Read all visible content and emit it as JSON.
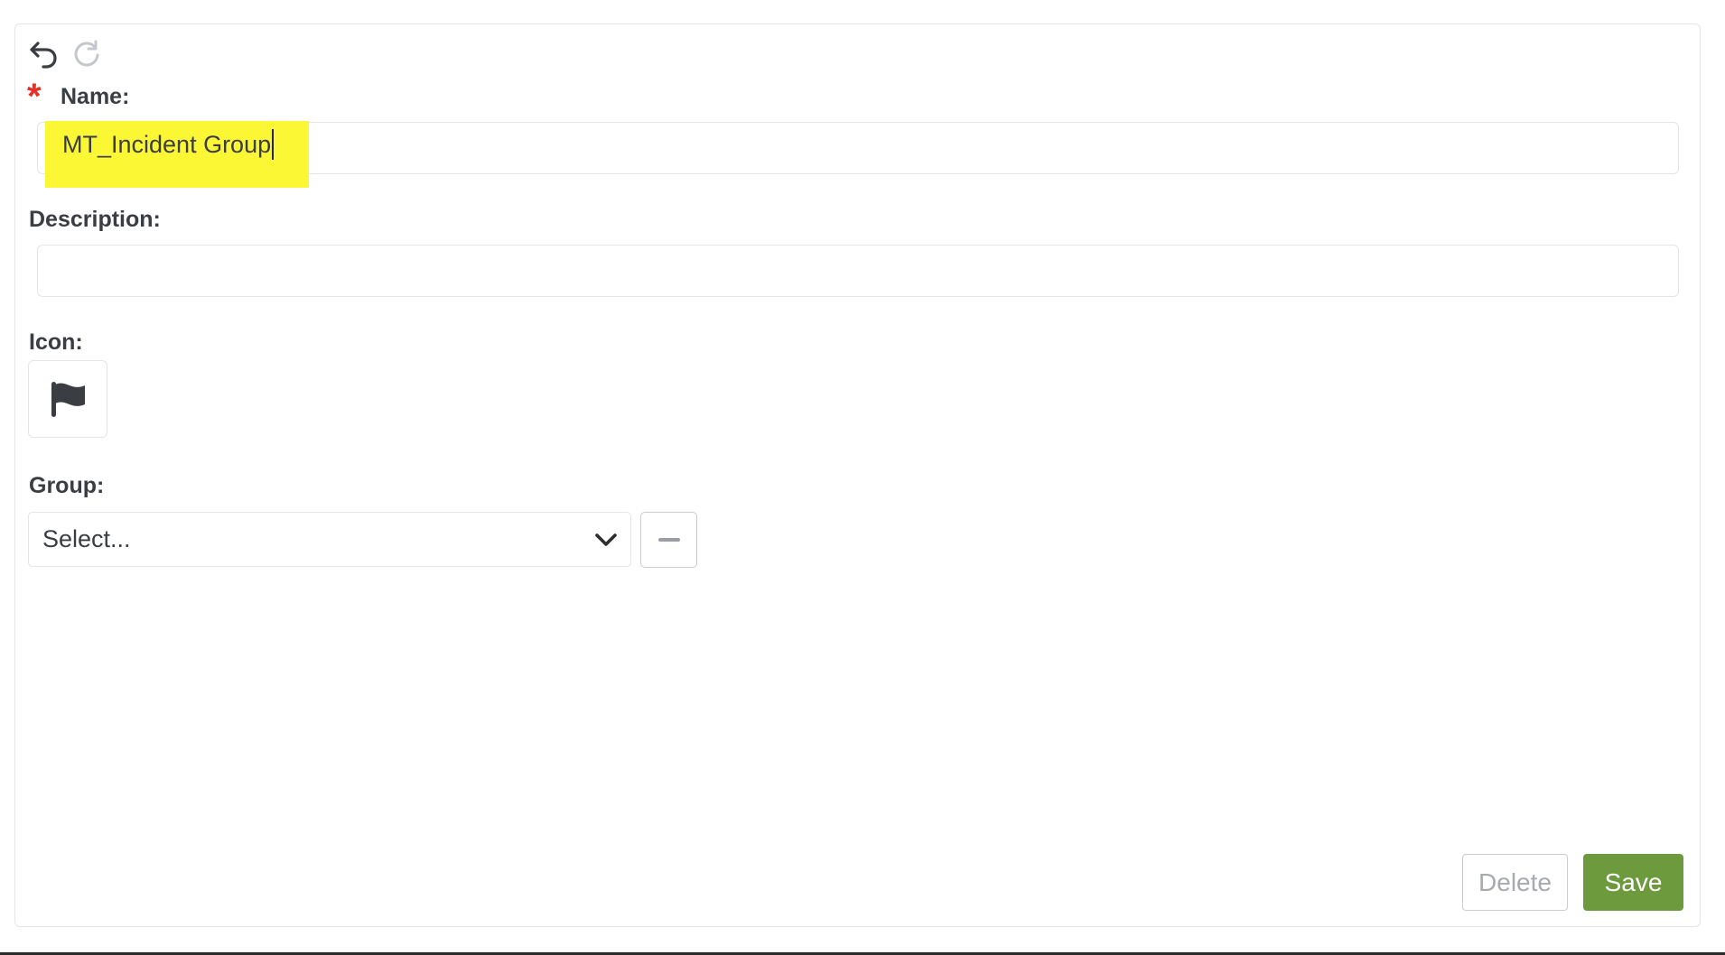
{
  "form": {
    "name_label": "Name:",
    "required_marker": "*",
    "name_value": "MT_Incident Group",
    "description_label": "Description:",
    "description_value": "",
    "icon_label": "Icon:",
    "icon": "flag-icon",
    "group_label": "Group:",
    "group_placeholder": "Select..."
  },
  "toolbar": {
    "undo_icon": "undo-icon",
    "redo_icon": "redo-icon"
  },
  "actions": {
    "delete_label": "Delete",
    "save_label": "Save"
  },
  "colors": {
    "required": "#e0312a",
    "highlight": "#fbf735",
    "save_button": "#6c9a3c",
    "text": "#3a3d42"
  }
}
